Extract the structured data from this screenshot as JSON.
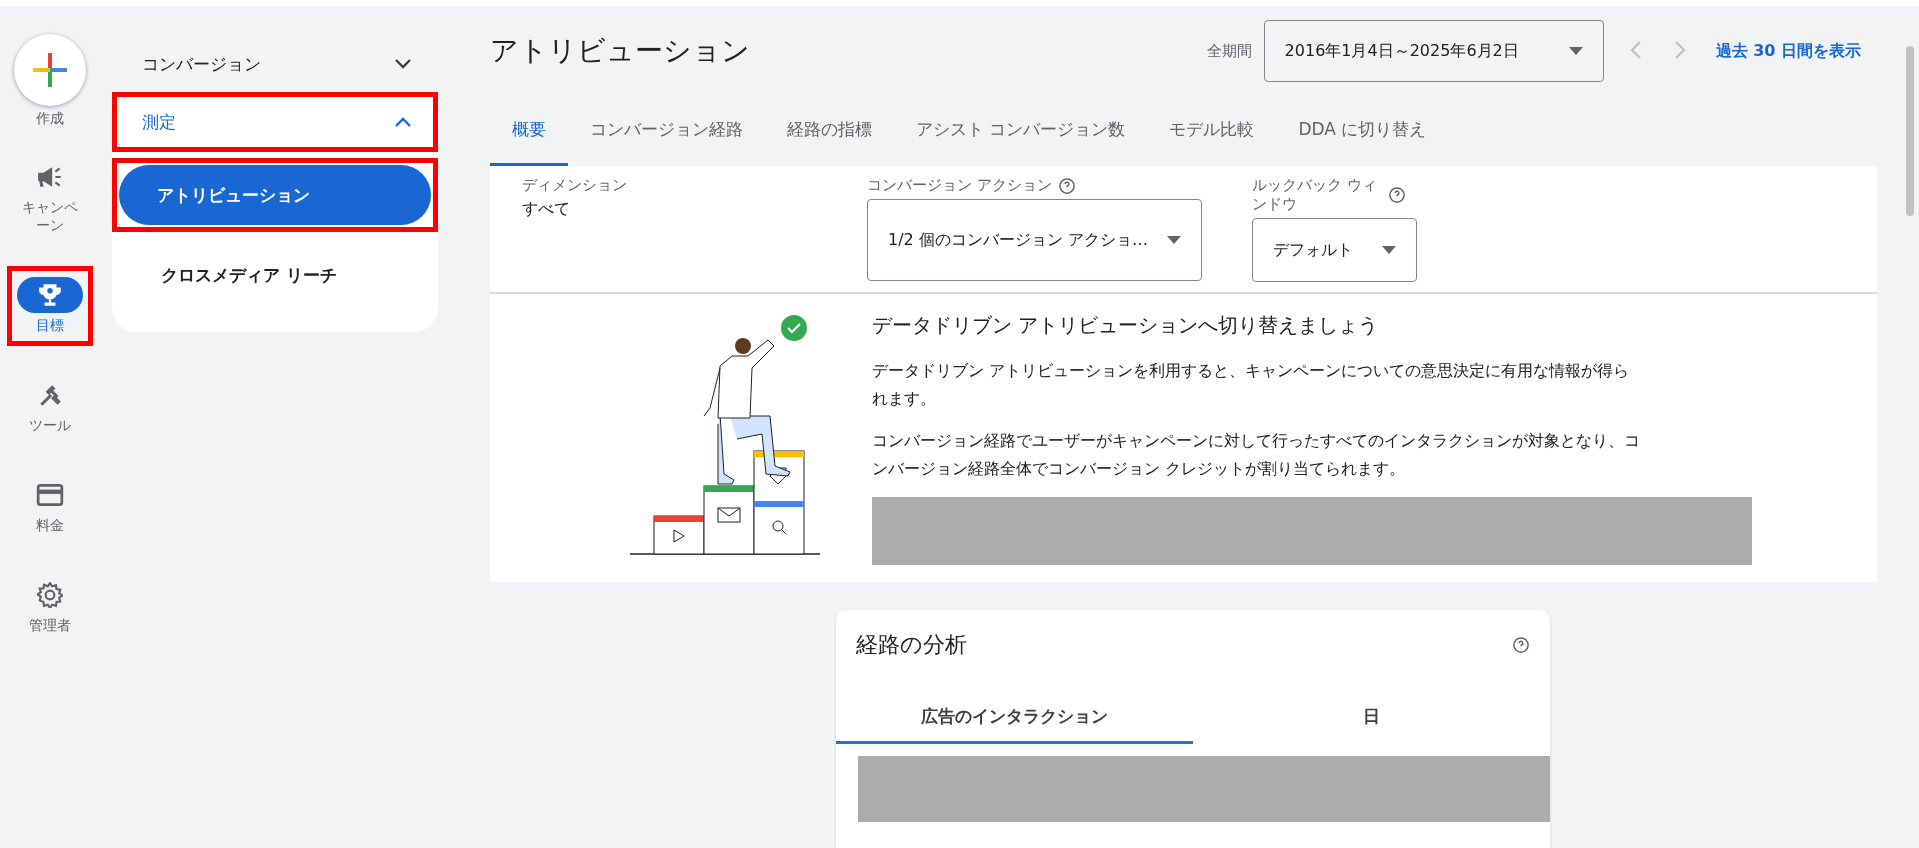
{
  "rail": {
    "create_label": "作成",
    "items": [
      {
        "label": "キャンペーン",
        "selected": false,
        "highlighted": false
      },
      {
        "label": "目標",
        "selected": true,
        "highlighted": true
      },
      {
        "label": "ツール",
        "selected": false,
        "highlighted": false
      },
      {
        "label": "料金",
        "selected": false,
        "highlighted": false
      },
      {
        "label": "管理者",
        "selected": false,
        "highlighted": false
      }
    ]
  },
  "submenu": {
    "section": {
      "label": "コンバージョン",
      "expanded": false
    },
    "group": {
      "label": "測定",
      "expanded": true,
      "highlighted": true
    },
    "items": [
      {
        "label": "アトリビューション",
        "selected": true,
        "highlighted": true
      },
      {
        "label": "クロスメディア リーチ",
        "selected": false,
        "highlighted": false
      }
    ]
  },
  "header": {
    "title": "アトリビューション",
    "period_label": "全期間",
    "date_range": "2016年1月4日～2025年6月2日",
    "link": "過去 30 日間を表示"
  },
  "tabs": [
    {
      "label": "概要",
      "selected": true
    },
    {
      "label": "コンバージョン経路",
      "selected": false
    },
    {
      "label": "経路の指標",
      "selected": false
    },
    {
      "label": "アシスト コンバージョン数",
      "selected": false
    },
    {
      "label": "モデル比較",
      "selected": false
    },
    {
      "label": "DDA に切り替え",
      "selected": false
    }
  ],
  "filters": [
    {
      "kind": "text",
      "label": "ディメンション",
      "value": "すべて"
    },
    {
      "kind": "select",
      "label": "コンバージョン アクション",
      "help": true,
      "value": "1/2 個のコンバージョン アクショ…"
    },
    {
      "kind": "select",
      "label": "ルックバック ウィンドウ",
      "help": true,
      "value": "デフォルト"
    }
  ],
  "banner": {
    "title": "データドリブン アトリビューションへ切り替えましょう",
    "paragraphs": [
      "データドリブン アトリビューションを利用すると、キャンペーンについての意思決定に有用な情報が得られます。",
      "コンバージョン経路でユーザーがキャンペーンに対して行ったすべてのインタラクションが対象となり、コンバージョン経路全体でコンバージョン クレジットが割り当てられます。"
    ]
  },
  "card": {
    "title": "経路の分析",
    "tabs": [
      {
        "label": "広告のインタラクション",
        "selected": true
      },
      {
        "label": "日",
        "selected": false
      }
    ]
  }
}
